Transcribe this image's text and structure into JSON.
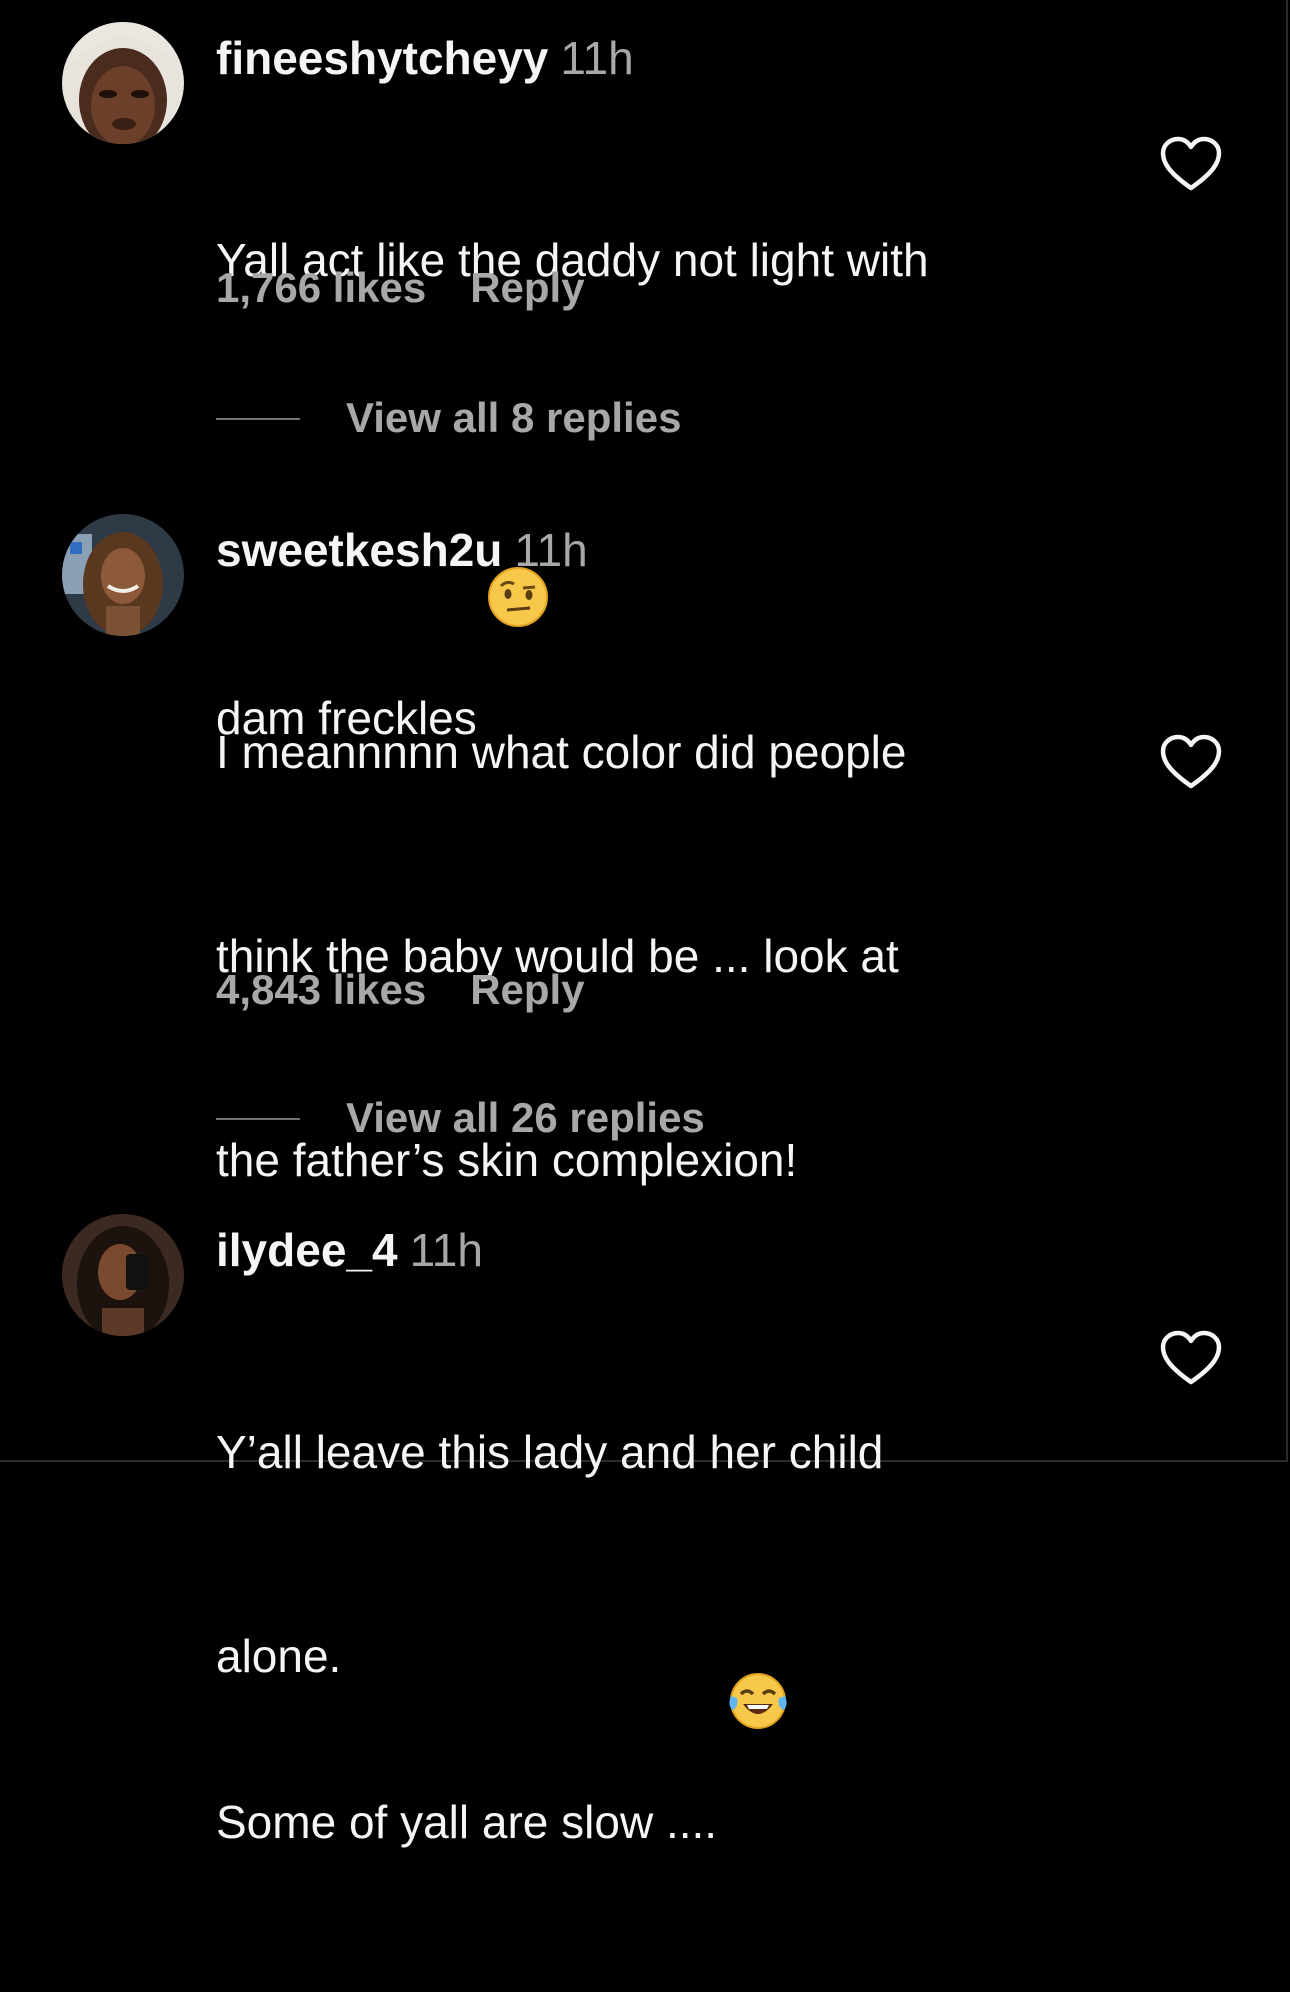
{
  "comments": [
    {
      "username": "fineeshytcheyy",
      "time": "11h",
      "lines": [
        "Yall act like the daddy not light with",
        "dam freckles"
      ],
      "emoji": "raised-eyebrow-emoji",
      "likes": "1,766 likes",
      "reply": "Reply",
      "view_replies": "View all 8 replies"
    },
    {
      "username": "sweetkesh2u",
      "time": "11h",
      "lines": [
        "I meannnnn what color did people",
        "think the baby would be ... look at",
        "the father’s skin complexion!",
        "",
        "Some of yall are slow ...."
      ],
      "emoji": "tears-of-joy-emoji",
      "likes": "4,843 likes",
      "reply": "Reply",
      "view_replies": "View all 26 replies"
    },
    {
      "username": "ilydee_4",
      "time": "11h",
      "lines": [
        "Y’all leave this lady and her child",
        "alone."
      ]
    }
  ],
  "icons": {
    "like": "heart-outline-icon"
  },
  "colors": {
    "background": "#000000",
    "primary_text": "#f5f5f5",
    "secondary_text": "#a8a8a8"
  }
}
